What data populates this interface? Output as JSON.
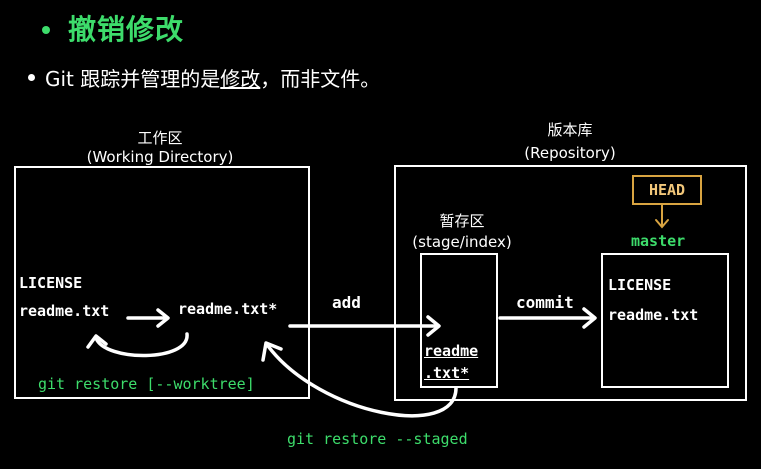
{
  "title": "撤销修改",
  "bullet": {
    "prefix": "Git 跟踪并管理的是",
    "emphasis": "修改",
    "suffix": "，而非文件。"
  },
  "working": {
    "title": "工作区",
    "subtitle": "(Working Directory)",
    "file_license": "LICENSE",
    "file_readme": "readme.txt",
    "file_readme_modified": "readme.txt*",
    "restore_cmd": "git restore [--worktree]"
  },
  "stage": {
    "title": "暂存区",
    "subtitle": "(stage/index)",
    "file_line1": "readme",
    "file_line2": ".txt*"
  },
  "repository": {
    "title": "版本库",
    "subtitle": "(Repository)",
    "head": "HEAD",
    "branch": "master",
    "file_license": "LICENSE",
    "file_readme": "readme.txt"
  },
  "arrows": {
    "add": "add",
    "commit": "commit",
    "restore_staged": "git restore --staged"
  },
  "colors": {
    "accent_green": "#3ddc6b",
    "head_border": "#d9a441",
    "background": "#000000"
  }
}
